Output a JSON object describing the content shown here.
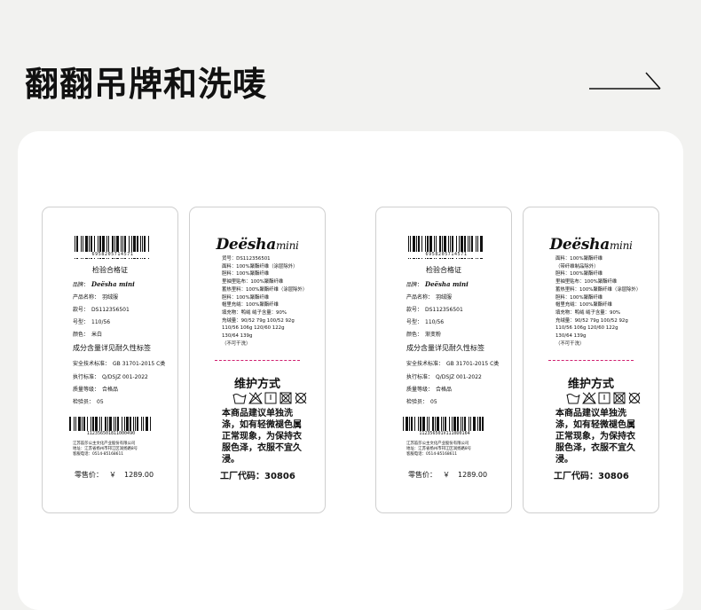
{
  "page": {
    "title": "翻翻吊牌和洗唛"
  },
  "icons": {
    "arrow": "arrow-right-icon",
    "barcode": "barcode-icon",
    "care": [
      "wash-basin-icon",
      "no-bleach-icon",
      "line-dry-icon",
      "no-tumble-dry-icon",
      "no-dry-clean-icon"
    ]
  },
  "colors": {
    "background": "#f2f2f0",
    "panel": "#ffffff",
    "dashed_line": "#d02070",
    "tag_border": "#cfcfcf"
  },
  "cards": [
    {
      "hangtag": {
        "barcode_number": "6958205714571",
        "title": "检验合格证",
        "brand_label": "品牌：",
        "brand_value": "Deësha mini",
        "product_label": "产品名称：",
        "product_value": "羽绒服",
        "style_label": "款号：",
        "style_value": "DS112356501",
        "size_label": "号型：",
        "size_value": "110/56",
        "color_label": "颜色：",
        "color_value": "米白",
        "durable_text": "成分含量详见耐久性标签",
        "standard_label": "安全技术标准：",
        "standard_value": "GB 31701-2015 C类",
        "exec_label": "执行标准：",
        "exec_value": "Q/DSJZ 001-2022",
        "quality_label": "质量等级：",
        "quality_value": "合格品",
        "inspector_label": "检验员：",
        "inspector_value": "05",
        "barcode2_number": "112356501811000490",
        "company_line1": "江苏笛莎公主文化产业股份有限公司",
        "company_line2": "地址：江苏省扬州市邗江区润扬路8号",
        "company_line3": "客服电话：0514-85168611",
        "price_label": "零售价：",
        "price_currency": "￥",
        "price_value": "1289.00"
      },
      "washlabel": {
        "brand": "Deësha",
        "brand_sub": "mini",
        "specs": [
          "货号：DS112356501",
          "面料：100%聚酯纤维（涂层除外）",
          "胆料：100%聚酯纤维",
          "里袖里贴布：100%聚酯纤维",
          "蓄热里料：100%聚酯纤维（涂层除外）",
          "胆料：100%聚酯纤维",
          "帽里充绒：100%聚酯纤维",
          "填充物：鸭绒  绒子含量：90%",
          "充绒量：90/52 79g 100/52 92g",
          "    110/56 106g 120/60 122g",
          "    130/64 139g",
          "    （不可干洗）"
        ],
        "care_title": "维护方式",
        "care_text": "本商品建议单独洗涤，如有轻微褪色属正常现象，为保持衣服色泽，衣服不宜久浸。",
        "factory_label": "工厂代码：",
        "factory_code": "30806"
      }
    },
    {
      "hangtag": {
        "barcode_number": "6958205714571",
        "title": "检验合格证",
        "brand_label": "品牌：",
        "brand_value": "Deësha mini",
        "product_label": "产品名称：",
        "product_value": "羽绒服",
        "style_label": "款号：",
        "style_value": "DS112356501",
        "size_label": "号型：",
        "size_value": "110/56",
        "color_label": "颜色：",
        "color_value": "渐变粉",
        "durable_text": "成分含量详见耐久性标签",
        "standard_label": "安全技术标准：",
        "standard_value": "GB 31701-2015 C类",
        "exec_label": "执行标准：",
        "exec_value": "Q/DSJZ 001-2022",
        "quality_label": "质量等级：",
        "quality_value": "合格品",
        "inspector_label": "检验员：",
        "inspector_value": "05",
        "barcode2_number": "112356501V1110D0164",
        "company_line1": "江苏笛莎公主文化产业股份有限公司",
        "company_line2": "地址：江苏省扬州市邗江区润扬路8号",
        "company_line3": "客服电话：0514-85168611",
        "price_label": "零售价：",
        "price_currency": "￥",
        "price_value": "1289.00"
      },
      "washlabel": {
        "brand": "Deësha",
        "brand_sub": "mini",
        "specs": [
          "面料：100%聚酯纤维",
          "    （带纤维制品除外）",
          "胆料：100%聚酯纤维",
          "里袖里贴布：100%聚酯纤维",
          "蓄热里料：100%聚酯纤维（涂层除外）",
          "胆料：100%聚酯纤维",
          "帽里充绒：100%聚酯纤维",
          "填充物：鸭绒  绒子含量：90%",
          "充绒量：90/52 79g 100/52 92g",
          "    110/56 106g 120/60 122g",
          "    130/64 139g",
          "    （不可干洗）"
        ],
        "care_title": "维护方式",
        "care_text": "本商品建议单独洗涤，如有轻微褪色属正常现象，为保持衣服色泽，衣服不宜久浸。",
        "factory_label": "工厂代码：",
        "factory_code": "30806"
      }
    }
  ]
}
